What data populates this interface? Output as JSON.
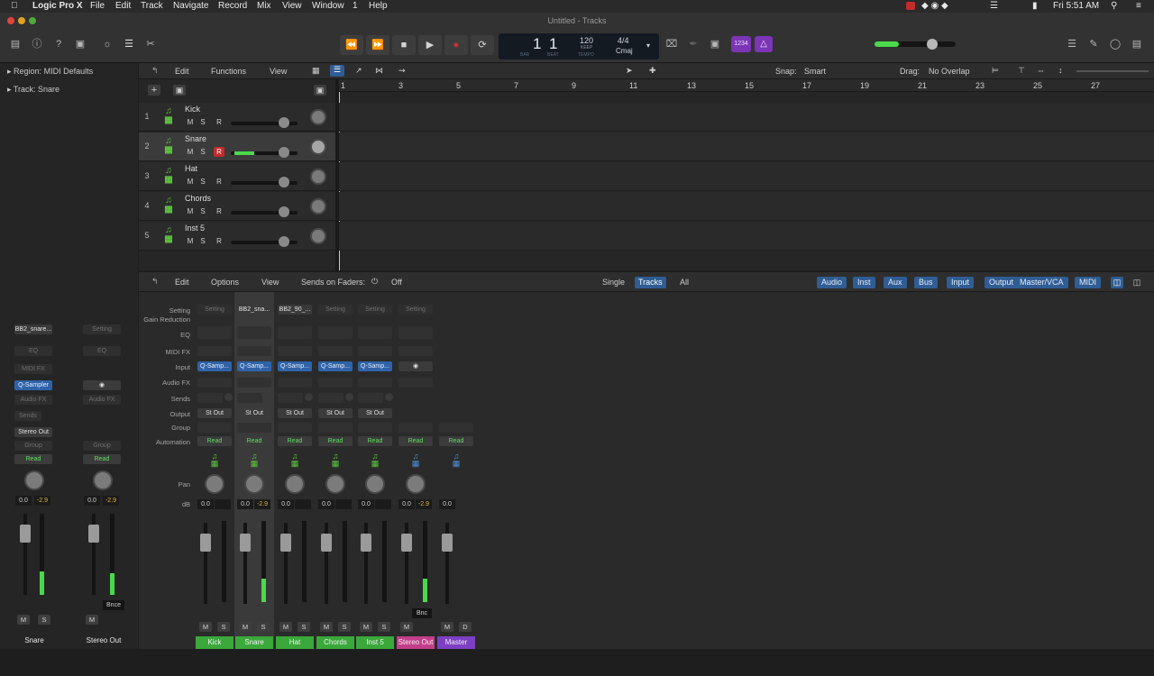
{
  "menubar": {
    "app": "Logic Pro X",
    "items": [
      "File",
      "Edit",
      "Track",
      "Navigate",
      "Record",
      "Mix",
      "View",
      "Window",
      "1",
      "Help"
    ],
    "clock": "Fri 5:51 AM"
  },
  "window": {
    "title": "Untitled - Tracks"
  },
  "lcd": {
    "bar": "1",
    "beat": "1",
    "bar_label": "BAR",
    "beat_label": "BEAT",
    "tempo": "120",
    "tempo_label": "TEMPO",
    "keep": "KEEP",
    "signature": "4/4",
    "key": "Cmaj"
  },
  "toolbar": {
    "count_in": "1234"
  },
  "inspector": {
    "region_label": "Region:",
    "region_value": "MIDI Defaults",
    "track_label": "Track:",
    "track_value": "Snare",
    "strip1": {
      "setting": "BB2_snare...",
      "eq": "EQ",
      "midifx": "MIDI FX",
      "instrument": "Q-Sampler",
      "audiofx": "Audio FX",
      "sends": "Sends",
      "output": "Stereo Out",
      "group": "Group",
      "automation": "Read",
      "vol": "0.0",
      "peak": "-2.9",
      "name": "Snare"
    },
    "strip2": {
      "setting": "Setting",
      "eq": "EQ",
      "audiofx": "Audio FX",
      "group": "Group",
      "automation": "Read",
      "vol": "0.0",
      "peak": "-2.9",
      "name": "Stereo Out",
      "bounce": "Bnce"
    }
  },
  "tracks_menu": {
    "edit": "Edit",
    "functions": "Functions",
    "view": "View",
    "snap_label": "Snap:",
    "snap_value": "Smart",
    "drag_label": "Drag:",
    "drag_value": "No Overlap"
  },
  "ruler": [
    "1",
    "3",
    "5",
    "7",
    "9",
    "11",
    "13",
    "15",
    "17",
    "19",
    "21",
    "23",
    "25",
    "27"
  ],
  "tracks": [
    {
      "num": "1",
      "name": "Kick"
    },
    {
      "num": "2",
      "name": "Snare"
    },
    {
      "num": "3",
      "name": "Hat"
    },
    {
      "num": "4",
      "name": "Chords"
    },
    {
      "num": "5",
      "name": "Inst 5"
    }
  ],
  "msr": {
    "m": "M",
    "s": "S",
    "r": "R"
  },
  "mixer": {
    "edit": "Edit",
    "options": "Options",
    "view": "View",
    "sends_on_faders": "Sends on Faders:",
    "sends_value": "Off",
    "view_tabs": [
      "Single",
      "Tracks",
      "All"
    ],
    "filters": [
      "Audio",
      "Inst",
      "Aux",
      "Bus",
      "Input",
      "Output",
      "Master/VCA",
      "MIDI"
    ],
    "row_labels": {
      "setting": "Setting",
      "gain": "Gain Reduction",
      "eq": "EQ",
      "midifx": "MIDI FX",
      "input": "Input",
      "audiofx": "Audio FX",
      "sends": "Sends",
      "output": "Output",
      "group": "Group",
      "automation": "Automation",
      "pan": "Pan",
      "db": "dB"
    },
    "strips": [
      {
        "name": "Kick",
        "setting": "Setting",
        "input": "Q-Samp...",
        "output": "St Out",
        "automation": "Read",
        "vol": "0.0",
        "peak": "",
        "color": "#3aa83a",
        "m": "M",
        "s": "S"
      },
      {
        "name": "Snare",
        "setting": "BB2_sna...",
        "input": "Q-Samp...",
        "output": "St Out",
        "automation": "Read",
        "vol": "0.0",
        "peak": "-2.9",
        "color": "#3aa83a",
        "m": "M",
        "s": "S"
      },
      {
        "name": "Hat",
        "setting": "BB2_90_...",
        "input": "Q-Samp...",
        "output": "St Out",
        "automation": "Read",
        "vol": "0.0",
        "peak": "",
        "color": "#3aa83a",
        "m": "M",
        "s": "S"
      },
      {
        "name": "Chords",
        "setting": "Setting",
        "input": "Q-Samp...",
        "output": "St Out",
        "automation": "Read",
        "vol": "0.0",
        "peak": "",
        "color": "#3aa83a",
        "m": "M",
        "s": "S"
      },
      {
        "name": "Inst 5",
        "setting": "Setting",
        "input": "Q-Samp...",
        "output": "St Out",
        "automation": "Read",
        "vol": "0.0",
        "peak": "",
        "color": "#3aa83a",
        "m": "M",
        "s": "S"
      },
      {
        "name": "Stereo Out",
        "setting": "Setting",
        "input": "",
        "output": "",
        "automation": "Read",
        "vol": "0.0",
        "peak": "-2.9",
        "color": "#c43d8a",
        "m": "M",
        "s": "",
        "bounce": "Bnc"
      },
      {
        "name": "Master",
        "setting": "",
        "input": "",
        "output": "",
        "automation": "Read",
        "vol": "0.0",
        "peak": "",
        "color": "#7d3fc4",
        "m": "M",
        "s": "D"
      }
    ]
  },
  "colors": {
    "accent": "#2f5d94",
    "record": "#c42b2b",
    "meter": "#49d94a",
    "track_green": "#5ec83e"
  }
}
